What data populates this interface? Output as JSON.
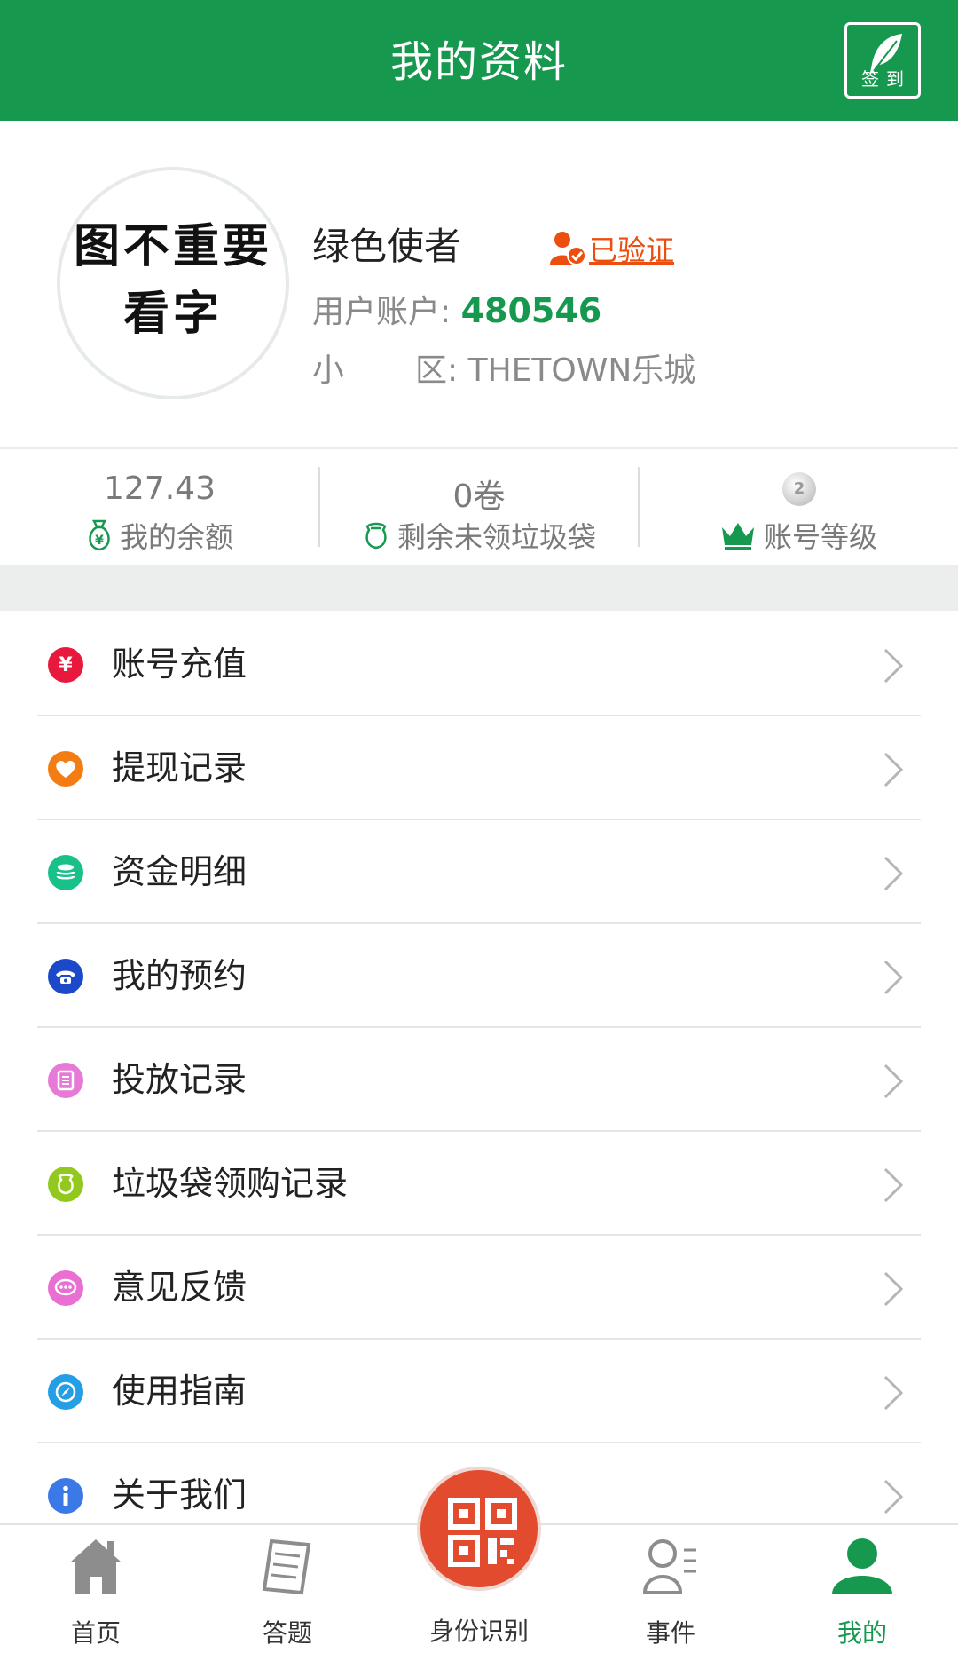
{
  "header": {
    "title": "我的资料",
    "signin_label": "签到",
    "color": "#16994f"
  },
  "profile": {
    "avatar_text_line1": "图不重要",
    "avatar_text_line2": "看字",
    "nickname": "绿色使者",
    "verified_label": "已验证",
    "account_label_1": "用户账户",
    "account_colon": ":",
    "account_value": "480546",
    "community_label_1": "小",
    "community_label_2": "区",
    "community_colon": ":",
    "community_value": "THETOWN乐城"
  },
  "stats": {
    "balance_value": "127.43",
    "balance_label": "我的余额",
    "bags_value": "0卷",
    "bags_label": "剩余未领垃圾袋",
    "level_badge": "2",
    "level_label": "账号等级"
  },
  "menu": [
    {
      "label": "账号充值",
      "icon": "yen-icon",
      "color": "#e8193d"
    },
    {
      "label": "提现记录",
      "icon": "heart-icon",
      "color": "#f37d12"
    },
    {
      "label": "资金明细",
      "icon": "coins-icon",
      "color": "#18c08a"
    },
    {
      "label": "我的预约",
      "icon": "phone-icon",
      "color": "#1c49c9"
    },
    {
      "label": "投放记录",
      "icon": "document-icon",
      "color": "#e77ad6"
    },
    {
      "label": "垃圾袋领购记录",
      "icon": "bag-icon",
      "color": "#93c81f"
    },
    {
      "label": "意见反馈",
      "icon": "chat-icon",
      "color": "#ea6fd3"
    },
    {
      "label": "使用指南",
      "icon": "compass-icon",
      "color": "#249fe6"
    },
    {
      "label": "关于我们",
      "icon": "info-icon",
      "color": "#3b79e6"
    }
  ],
  "bottom_nav": {
    "home": "首页",
    "quiz": "答题",
    "identify": "身份识别",
    "events": "事件",
    "mine": "我的",
    "active_color": "#16994f",
    "fab_color": "#e24b2e"
  }
}
